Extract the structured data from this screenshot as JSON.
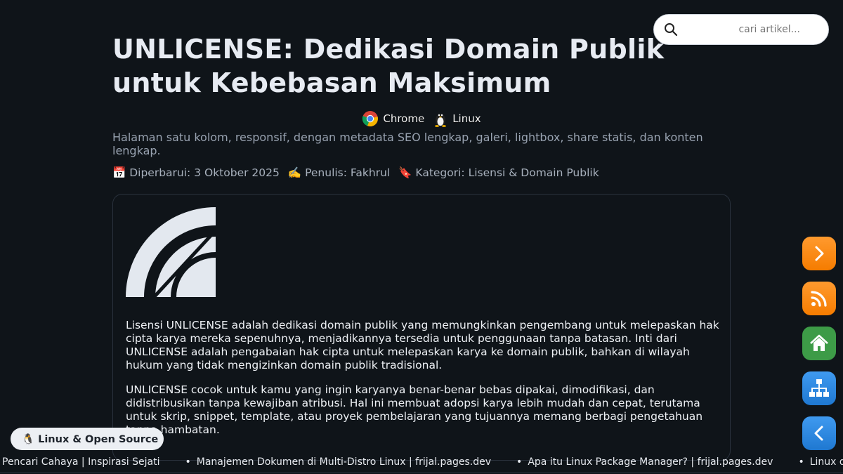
{
  "search": {
    "placeholder": "cari artikel..."
  },
  "article": {
    "title": "UNLICENSE: Dedikasi Domain Publik untuk Kebebasan Maksimum",
    "browsers": [
      {
        "label": "Chrome",
        "icon": "chrome-icon"
      },
      {
        "label": "Linux",
        "icon": "tux-icon"
      }
    ],
    "subtitle": "Halaman satu kolom, responsif, dengan metadata SEO lengkap, galeri, lightbox, share statis, dan konten lengkap.",
    "meta": {
      "updated": "📅 Diperbarui: 3 Oktober 2025",
      "author": "✍️ Penulis: Fakhrul",
      "category": "🔖 Kategori: Lisensi & Domain Publik"
    },
    "paragraphs": [
      "Lisensi UNLICENSE adalah dedikasi domain publik yang memungkinkan pengembang untuk melepaskan hak cipta karya mereka sepenuhnya, menjadikannya tersedia untuk penggunaan tanpa batasan. Inti dari UNLICENSE adalah pengabaian hak cipta untuk melepaskan karya ke domain publik, bahkan di wilayah hukum yang tidak mengizinkan domain publik tradisional.",
      "UNLICENSE cocok untuk kamu yang ingin karyanya benar-benar bebas dipakai, dimodifikasi, dan didistribusikan tanpa kewajiban atribusi. Hal ini membuat adopsi karya lebih mudah dan cepat, terutama untuk skrip, snippet, template, atau proyek pembelajaran yang tujuannya memang berbagi pengetahuan tanpa hambatan."
    ]
  },
  "tag": {
    "label": "🐧 Linux & Open Source"
  },
  "side_buttons": [
    {
      "name": "next-button",
      "icon": "chevron-right-icon",
      "color": "#f57c00"
    },
    {
      "name": "rss-button",
      "icon": "rss-icon",
      "color": "#f57c00"
    },
    {
      "name": "home-button",
      "icon": "home-icon",
      "color": "#3d9b47"
    },
    {
      "name": "sitemap-button",
      "icon": "sitemap-icon",
      "color": "#1f78d1"
    },
    {
      "name": "back-button",
      "icon": "chevron-left-icon",
      "color": "#1f78d1"
    }
  ],
  "ticker": [
    "Pencari Cahaya | Inspirasi Sejati",
    "Manajemen Dokumen di Multi-Distro Linux | frijal.pages.dev",
    "Apa itu Linux Package Manager? | frijal.pages.dev",
    "Linux dan In"
  ]
}
